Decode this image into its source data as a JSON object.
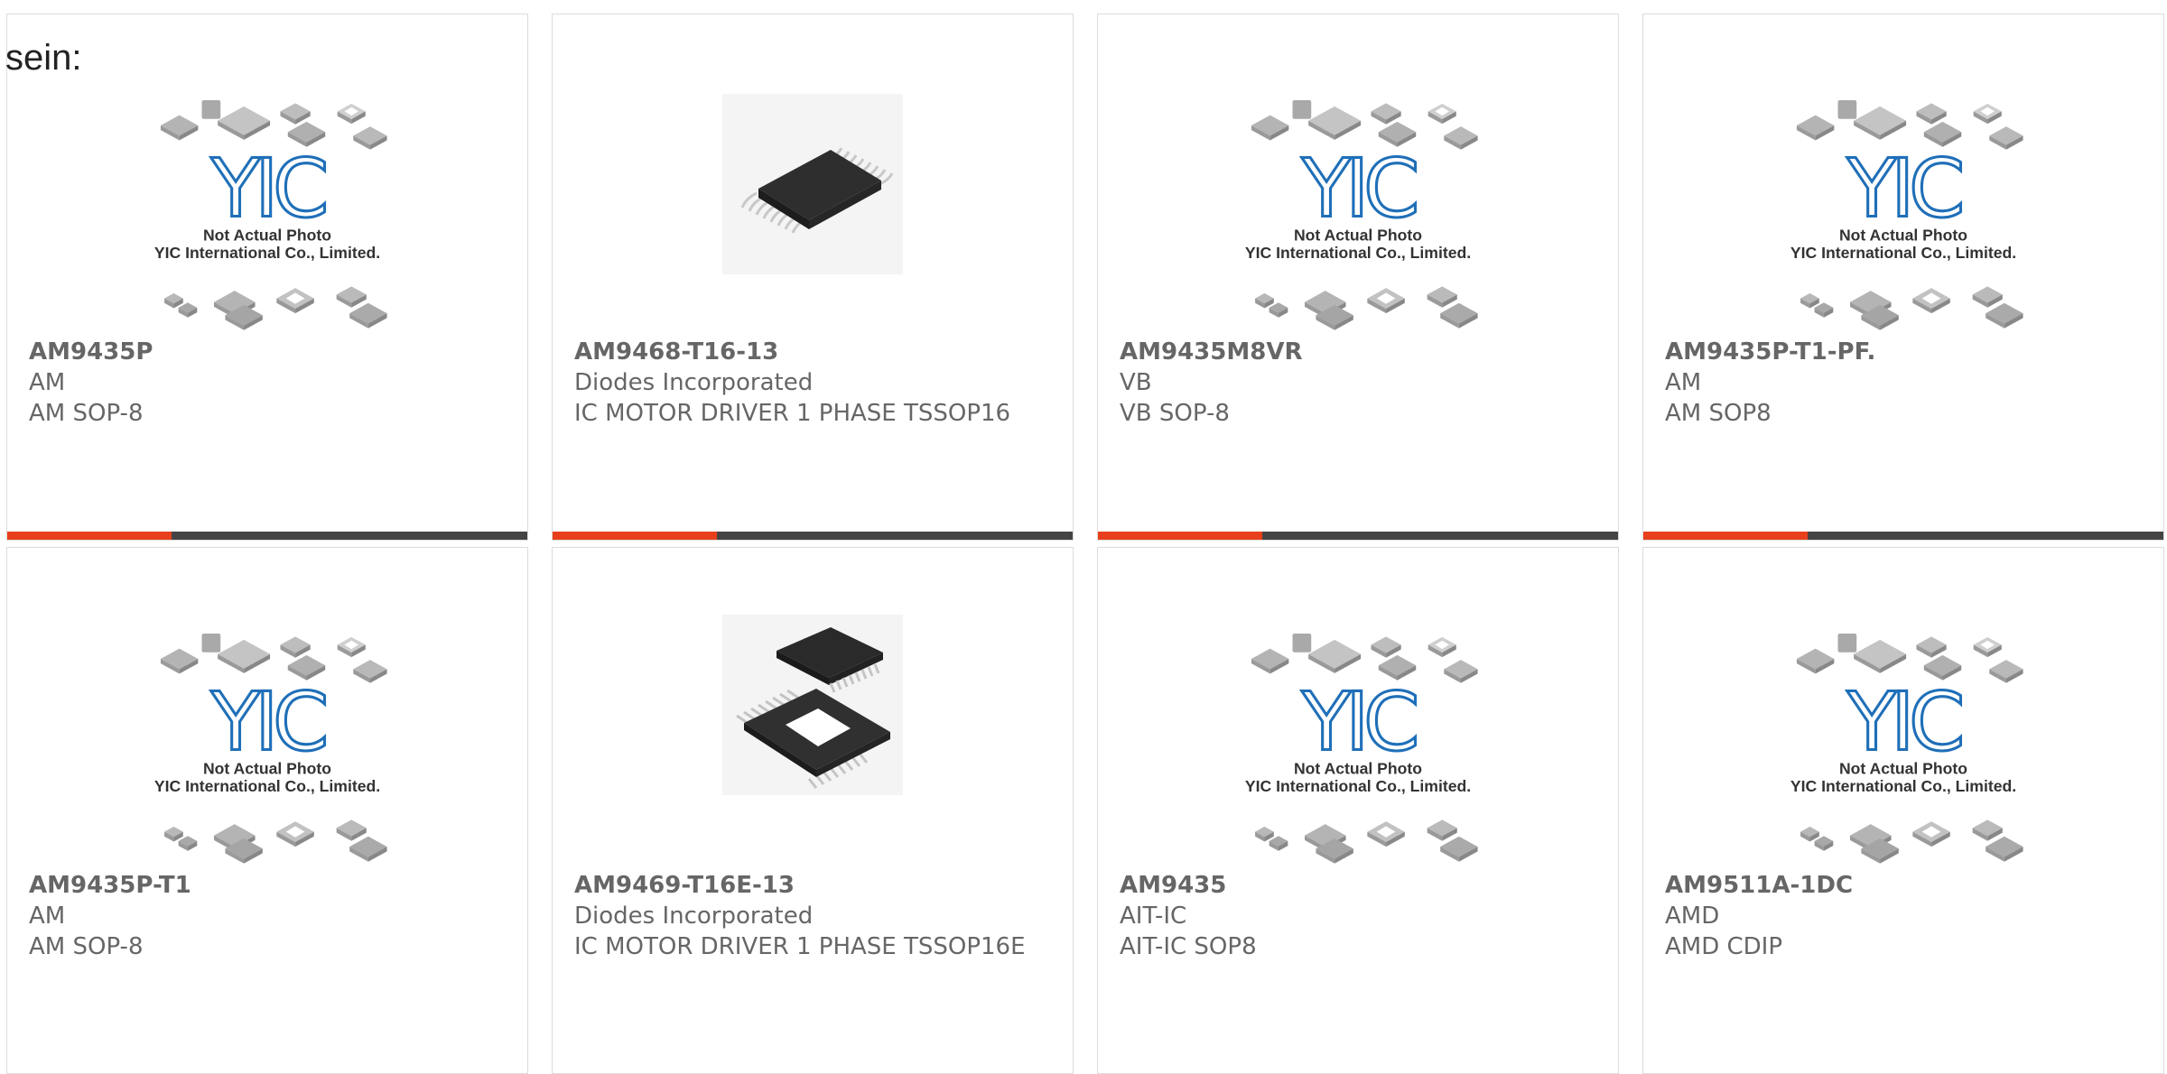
{
  "intro_text": "sein:",
  "colors": {
    "accent": "#e8401c",
    "bar": "#444444",
    "logo_blue": "#1f6fb8",
    "text": "#666666"
  },
  "placeholder": {
    "line1": "Not Actual Photo",
    "line2": "YIC International Co., Limited.",
    "logo": "YIC"
  },
  "products": [
    {
      "part_number": "AM9435P",
      "manufacturer": "AM",
      "description": "AM SOP-8",
      "image": "placeholder"
    },
    {
      "part_number": "AM9468-T16-13",
      "manufacturer": "Diodes Incorporated",
      "description": "IC MOTOR DRIVER 1 PHASE TSSOP16",
      "image": "tssop-chip"
    },
    {
      "part_number": "AM9435M8VR",
      "manufacturer": "VB",
      "description": "VB SOP-8",
      "image": "placeholder"
    },
    {
      "part_number": "AM9435P-T1-PF.",
      "manufacturer": "AM",
      "description": "AM SOP8",
      "image": "placeholder"
    },
    {
      "part_number": "AM9435P-T1",
      "manufacturer": "AM",
      "description": "AM SOP-8",
      "image": "placeholder"
    },
    {
      "part_number": "AM9469-T16E-13",
      "manufacturer": "Diodes Incorporated",
      "description": "IC MOTOR DRIVER 1 PHASE TSSOP16E",
      "image": "tssop-pad-chip"
    },
    {
      "part_number": "AM9435",
      "manufacturer": "AIT-IC",
      "description": "AIT-IC SOP8",
      "image": "placeholder"
    },
    {
      "part_number": "AM9511A-1DC",
      "manufacturer": "AMD",
      "description": "AMD CDIP",
      "image": "placeholder"
    }
  ]
}
